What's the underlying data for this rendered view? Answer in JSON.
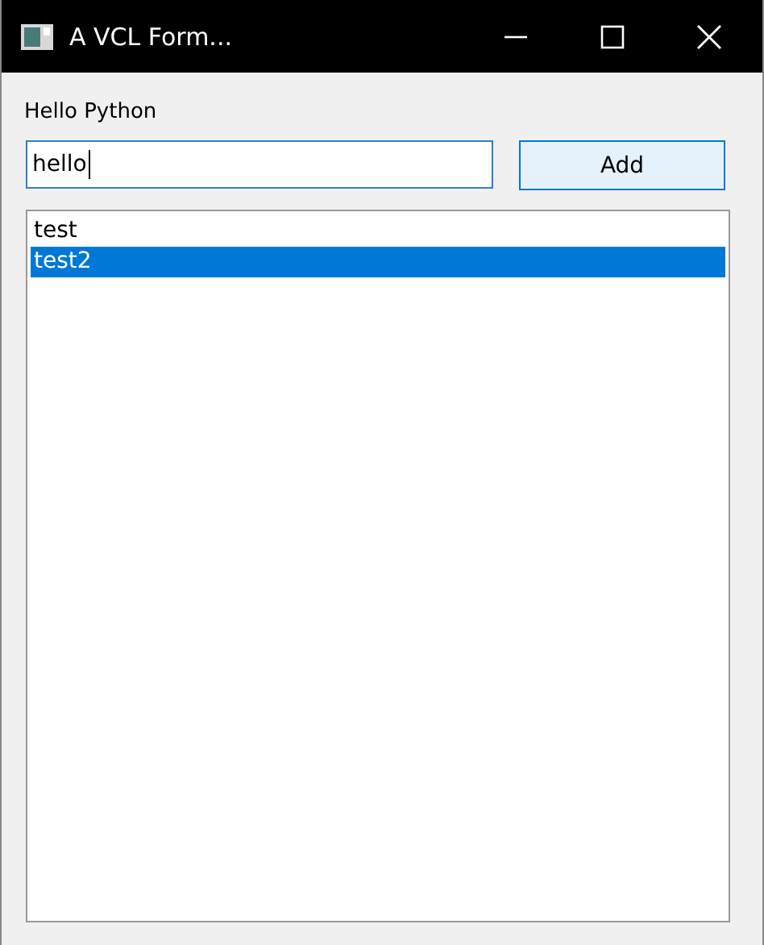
{
  "window": {
    "title": "A VCL Form..."
  },
  "label": "Hello Python",
  "input": {
    "value": "hello"
  },
  "button": "Add",
  "list": {
    "items": [
      {
        "text": "test",
        "selected": false
      },
      {
        "text": "test2",
        "selected": true
      }
    ]
  }
}
